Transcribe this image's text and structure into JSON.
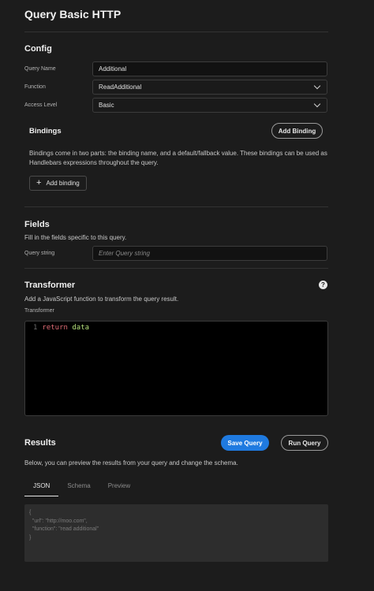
{
  "header": {
    "title": "Query Basic HTTP"
  },
  "config": {
    "title": "Config",
    "query_name": {
      "label": "Query Name",
      "value": "Additional"
    },
    "function": {
      "label": "Function",
      "value": "ReadAdditional"
    },
    "access_level": {
      "label": "Access Level",
      "value": "Basic"
    }
  },
  "bindings": {
    "title": "Bindings",
    "add_button": "Add Binding",
    "description_line1": "Bindings come in two parts: the binding name, and a default/fallback value. These bindings can be used as",
    "description_line2": "Handlebars expressions throughout the query.",
    "add_inline_button": "Add binding"
  },
  "fields": {
    "title": "Fields",
    "description": "Fill in the fields specific to this query.",
    "query_string": {
      "label": "Query string",
      "placeholder": "Enter Query string"
    }
  },
  "transformer": {
    "title": "Transformer",
    "description": "Add a JavaScript function to transform the query result.",
    "label": "Transformer",
    "code": {
      "line_number": "1",
      "keyword": "return",
      "identifier": "data"
    }
  },
  "results": {
    "title": "Results",
    "save_button": "Save Query",
    "run_button": "Run Query",
    "description": "Below, you can preview the results from your query and change the schema.",
    "tabs": [
      "JSON",
      "Schema",
      "Preview"
    ],
    "active_tab": "JSON",
    "preview_json": "{\n  \"url\": \"http://moo.com\",\n  \"function\": \"read additional\"\n}"
  },
  "colors": {
    "accent": "#1f7ae0",
    "background": "#1c1c1c"
  }
}
